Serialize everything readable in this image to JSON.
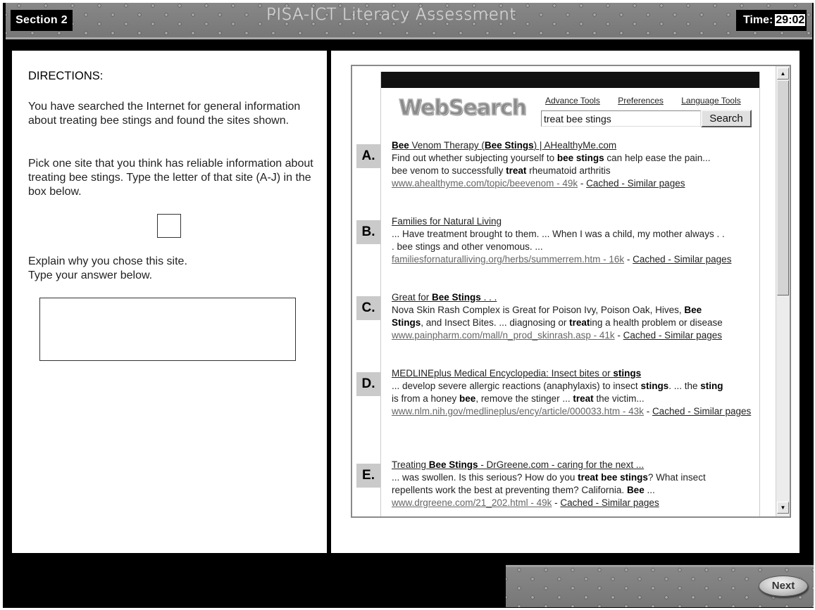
{
  "header": {
    "section_label": "Section 2",
    "title": "PISA-ICT Literacy Assessment",
    "timer_label": "Time:",
    "timer_value": "29:02"
  },
  "directions": {
    "title": "DIRECTIONS:",
    "paragraph_1": "You have searched the Internet for general information about treating bee stings and found the sites shown.",
    "paragraph_2": "Pick one site that you think has reliable information about treating bee stings. Type the letter of that site (A-J) in the box below.",
    "paragraph_3_line_1": "Explain why you chose this site.",
    "paragraph_3_line_2": "Type your answer below.",
    "letter_input_value": "",
    "answer_input_value": ""
  },
  "websearch": {
    "logo_text": "WebSearch",
    "links": [
      "Advance Tools",
      "Preferences",
      "Language Tools"
    ],
    "query": "treat bee stings",
    "search_button": "Search",
    "results": [
      {
        "letter": "A.",
        "title_html": "<b>Bee</b> Venom Therapy (<b>Bee Stings</b>) | AHealthyMe.com",
        "snippet_html": "Find out whether subjecting yourself to <b>bee stings</b> can help ease the pain...<br>bee venom to successfully <b>treat</b> rheumatoid arthritis",
        "url": "www.ahealthyme.com/topic/beevenom - 49k",
        "extra_links": "Cached - Similar pages"
      },
      {
        "letter": "B.",
        "title_html": "Families for Natural Living",
        "snippet_html": "... Have treatment brought to them. ... When I was a child, my mother always . .<br>. bee stings and other venomous. ...",
        "url": "familiesfornaturalliving.org/herbs/summerrem.htm - 16k",
        "extra_links": "Cached - Similar pages"
      },
      {
        "letter": "C.",
        "title_html": "Great for <b>Bee Stings</b> . . .",
        "snippet_html": "Nova Skin Rash Complex is Great for Poison Ivy, Poison Oak, Hives, <b>Bee</b><br><b>Stings</b>, and Insect Bites. ... diagnosing or <b>treat</b>ing a health problem or disease",
        "url": "www.painpharm.com/mall/n_prod_skinrash.asp - 41k",
        "extra_links": "Cached - Similar pages"
      },
      {
        "letter": "D.",
        "title_html": "MEDLINEplus Medical Encyclopedia: Insect bites or <b>stings</b>",
        "snippet_html": "... develop severe allergic reactions (anaphylaxis) to insect <b>stings</b>. ... the <b>sting</b><br>is from a honey <b>bee</b>, remove the stinger ... <b>treat</b> the victim...",
        "url": "www.nlm.nih.gov/medlineplus/ency/article/000033.htm - 43k",
        "extra_links": "Cached - Similar pages"
      },
      {
        "letter": "E.",
        "title_html": "Treating <b>Bee Stings</b> - DrGreene.com - caring for the next ...",
        "snippet_html": "... was swollen. Is this serious? How do you <b>treat bee stings</b>? What insect<br>repellents work the best at preventing them? California. <b>Bee</b> ...",
        "url": "www.drgreene.com/21_202.html - 49k",
        "extra_links": "Cached - Similar pages"
      }
    ]
  },
  "scrollbar": {
    "up_icon": "▲",
    "down_icon": "▼"
  },
  "footer": {
    "next_label": "Next"
  }
}
